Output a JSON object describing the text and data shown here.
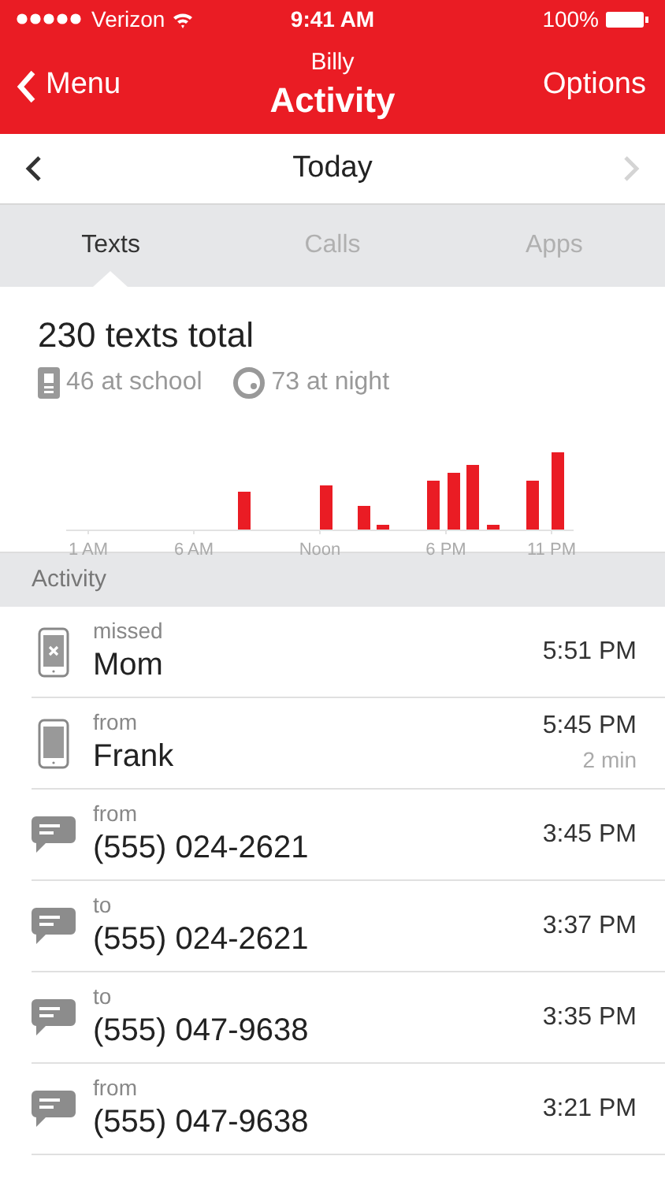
{
  "status_bar": {
    "carrier": "Verizon",
    "time": "9:41 AM",
    "battery": "100%"
  },
  "nav_bar": {
    "back": "Menu",
    "subtitle": "Billy",
    "title": "Activity",
    "action": "Options"
  },
  "date_bar": {
    "label": "Today",
    "previous_disabled": false,
    "next_disabled": true
  },
  "tabs": [
    {
      "label": "Texts",
      "selected": true
    },
    {
      "label": "Calls",
      "selected": false
    },
    {
      "label": "Apps",
      "selected": false
    }
  ],
  "summary": {
    "total": "230 texts total",
    "school": "46 at school",
    "night": "73 at night",
    "axis_labels": [
      "1 AM",
      "6 AM",
      "Noon",
      "6 PM",
      "11 PM"
    ]
  },
  "section_header": "Activity",
  "rows": [
    {
      "kind": "missed_call",
      "direction": "missed",
      "name": "Mom",
      "time": "5:51 PM"
    },
    {
      "kind": "call",
      "direction": "from",
      "name": "Frank",
      "time": "5:45 PM",
      "duration": "2 min"
    },
    {
      "kind": "text",
      "direction": "from",
      "name": "(555) 024-2621",
      "time": "3:45 PM"
    },
    {
      "kind": "text",
      "direction": "to",
      "name": "(555) 024-2621",
      "time": "3:37 PM"
    },
    {
      "kind": "text",
      "direction": "to",
      "name": "(555) 047-9638",
      "time": "3:35 PM"
    },
    {
      "kind": "text",
      "direction": "from",
      "name": "(555) 047-9638",
      "time": "3:21 PM"
    }
  ]
}
